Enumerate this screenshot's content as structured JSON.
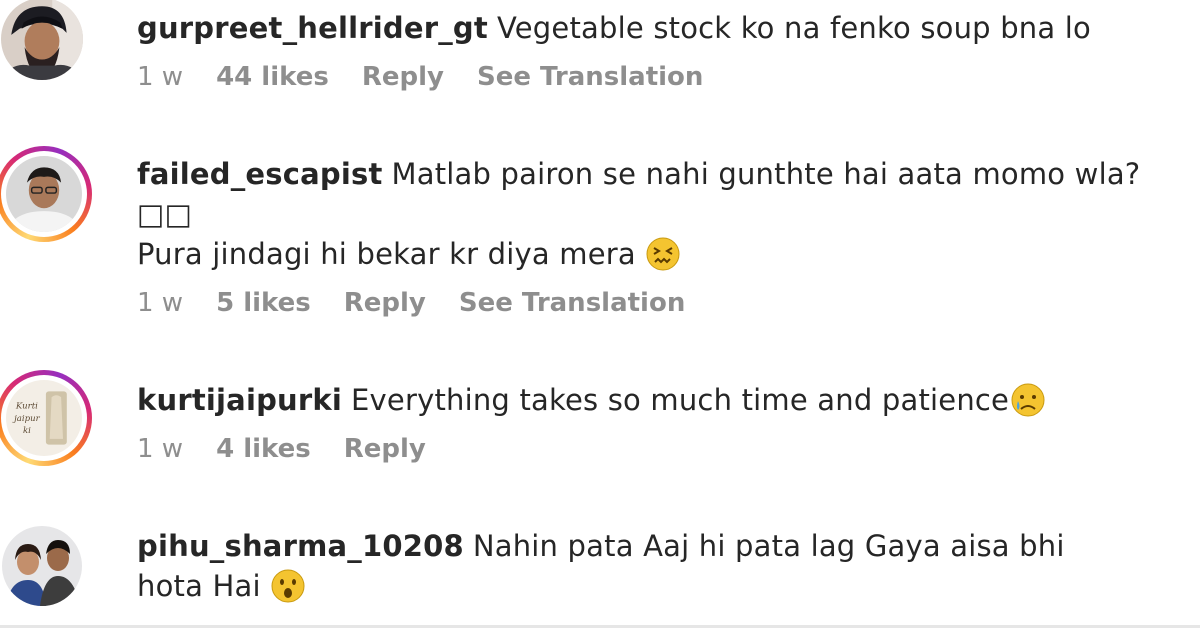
{
  "comments": [
    {
      "username": "gurpreet_hellrider_gt",
      "text": "Vegetable stock ko na fenko soup bna lo",
      "time": "1 w",
      "likes": "44 likes",
      "reply": "Reply",
      "translate": "See Translation",
      "avatar_icon": "profile-photo-man-turban",
      "has_story_ring": false
    },
    {
      "username": "failed_escapist",
      "text_line1": "Matlab pairon se nahi gunthte hai aata momo wla?□□",
      "text_line2": "Pura jindagi hi bekar kr diya mera",
      "emoji_icon": "confounded-face-emoji",
      "time": "1 w",
      "likes": "5 likes",
      "reply": "Reply",
      "translate": "See Translation",
      "avatar_icon": "profile-photo-man-glasses",
      "has_story_ring": true
    },
    {
      "username": "kurtijaipurki",
      "text": "Everything takes so much time and patience",
      "emoji_icon": "sad-tear-face-emoji",
      "time": "1 w",
      "likes": "4 likes",
      "reply": "Reply",
      "avatar_icon": "brand-logo-kurti",
      "avatar_logo_text": "Kurti jaipur ki",
      "has_story_ring": true
    },
    {
      "username": "pihu_sharma_10208",
      "text_line1": "Nahin pata Aaj hi pata lag Gaya aisa bhi",
      "text_line2": "hota Hai",
      "emoji_icon": "surprised-face-emoji",
      "avatar_icon": "profile-photo-couple",
      "has_story_ring": false
    }
  ],
  "colors": {
    "username": "#262626",
    "meta": "#8e8e8e",
    "emoji": "#f4c430"
  }
}
